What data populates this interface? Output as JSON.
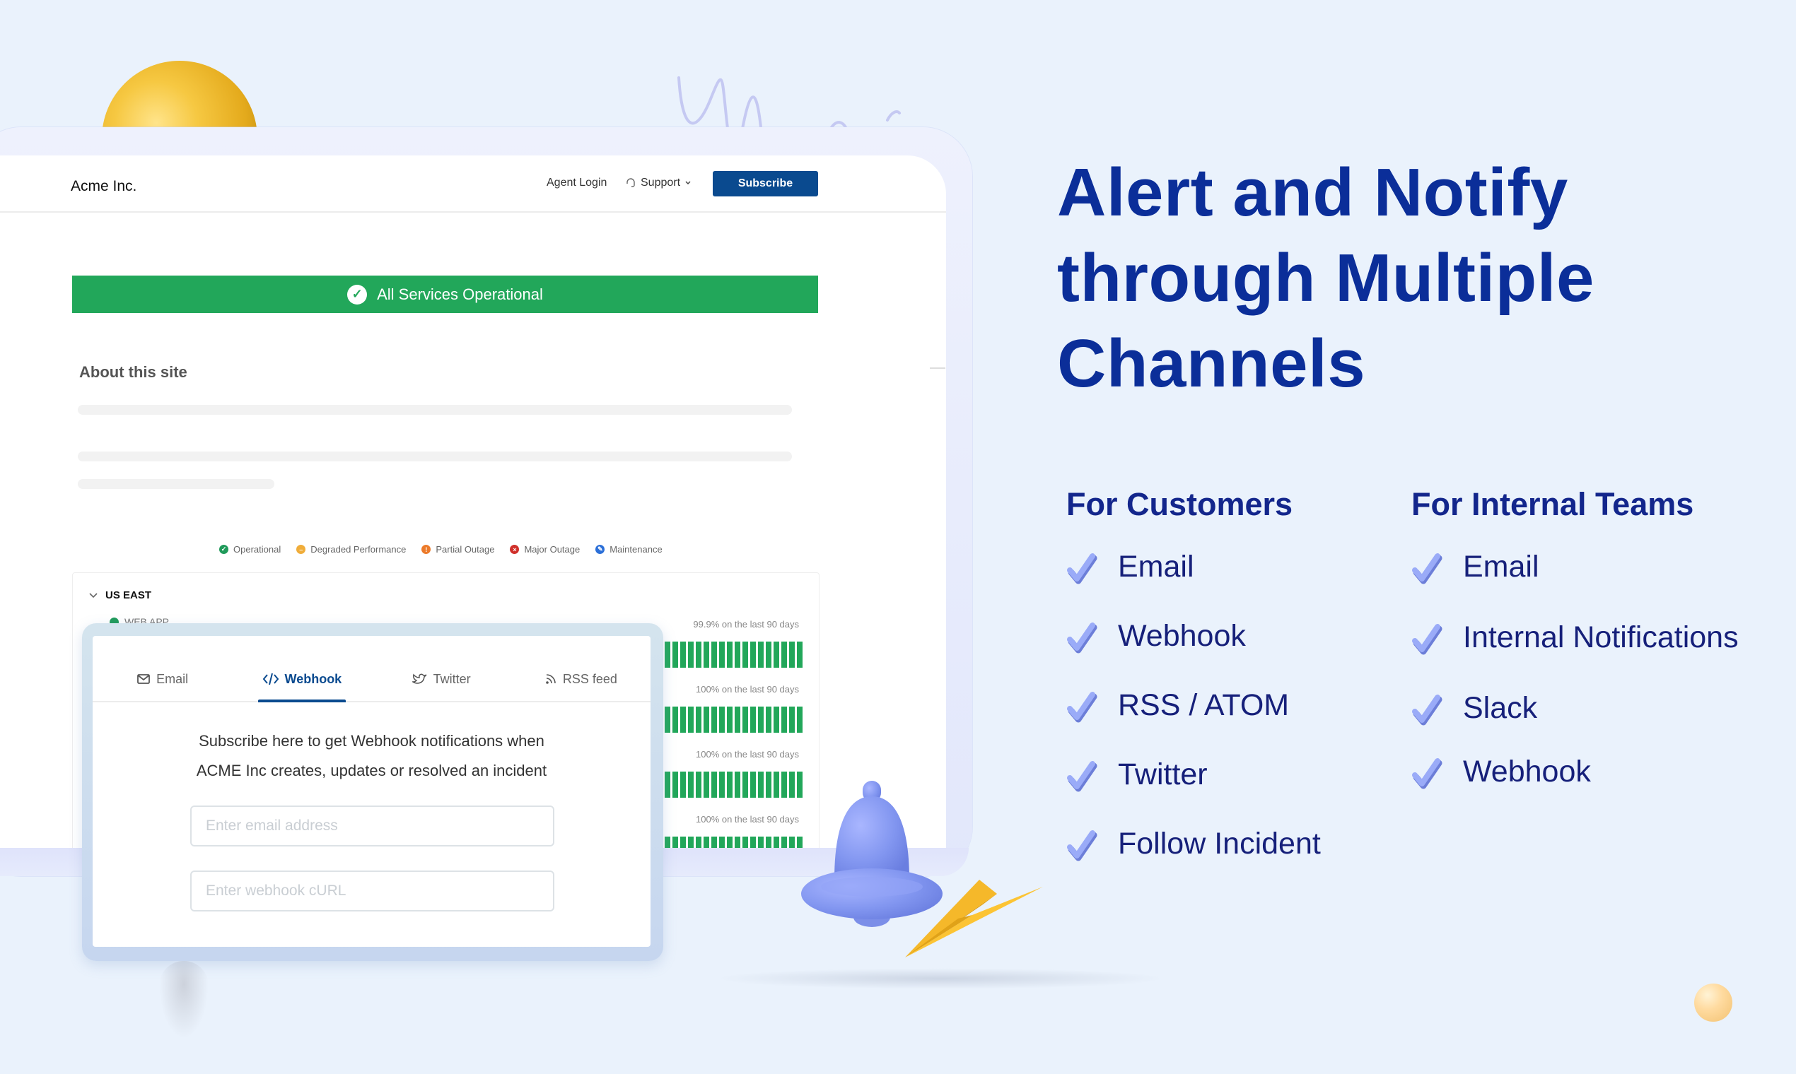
{
  "status_page": {
    "brand": "Acme Inc.",
    "nav": {
      "agent_login": "Agent Login",
      "support": "Support",
      "subscribe": "Subscribe"
    },
    "banner": {
      "text": "All Services Operational",
      "color": "#22a75a"
    },
    "about_title": "About this site",
    "legend": [
      {
        "label": "Operational",
        "color": "#1f9a5a",
        "glyph": "✓"
      },
      {
        "label": "Degraded Performance",
        "color": "#f0ad3a",
        "glyph": "–"
      },
      {
        "label": "Partial Outage",
        "color": "#ec7a2a",
        "glyph": "!"
      },
      {
        "label": "Major Outage",
        "color": "#d0302a",
        "glyph": "×"
      },
      {
        "label": "Maintenance",
        "color": "#2b6fd8",
        "glyph": "✎"
      }
    ],
    "region": {
      "name": "US EAST",
      "first_component": "WEB APP",
      "uptime_rows": [
        {
          "label": "99.9% on the last 90 days",
          "uptime_percent": 99.9
        },
        {
          "label": "100% on the last 90 days",
          "uptime_percent": 100
        },
        {
          "label": "100% on the last 90 days",
          "uptime_percent": 100
        },
        {
          "label": "100% on the last 90 days",
          "uptime_percent": 100
        }
      ]
    }
  },
  "subscribe_widget": {
    "tabs": [
      {
        "label": "Email",
        "icon": "envelope-icon",
        "active": false
      },
      {
        "label": "Webhook",
        "icon": "code-icon",
        "active": true
      },
      {
        "label": "Twitter",
        "icon": "twitter-bird-icon",
        "active": false
      },
      {
        "label": "RSS feed",
        "icon": "rss-icon",
        "active": false
      }
    ],
    "description_line1": "Subscribe here to get Webhook notifications when",
    "description_line2": "ACME Inc creates, updates or resolved an incident",
    "email_placeholder": "Enter email address",
    "webhook_placeholder": "Enter webhook cURL"
  },
  "marketing": {
    "headline_line1": "Alert and Notify",
    "headline_line2": "through Multiple",
    "headline_line3": "Channels",
    "customers": {
      "title": "For Customers",
      "items": [
        "Email",
        "Webhook",
        "RSS / ATOM",
        "Twitter",
        "Follow Incident"
      ]
    },
    "internal": {
      "title": "For Internal Teams",
      "items": [
        "Email",
        "Internal Notifications",
        "Slack",
        "Webhook"
      ]
    }
  },
  "colors": {
    "background": "#eaf2fc",
    "headline": "#0b2e99",
    "accent_blue": "#0a4a8f",
    "check": "#8095f0"
  }
}
